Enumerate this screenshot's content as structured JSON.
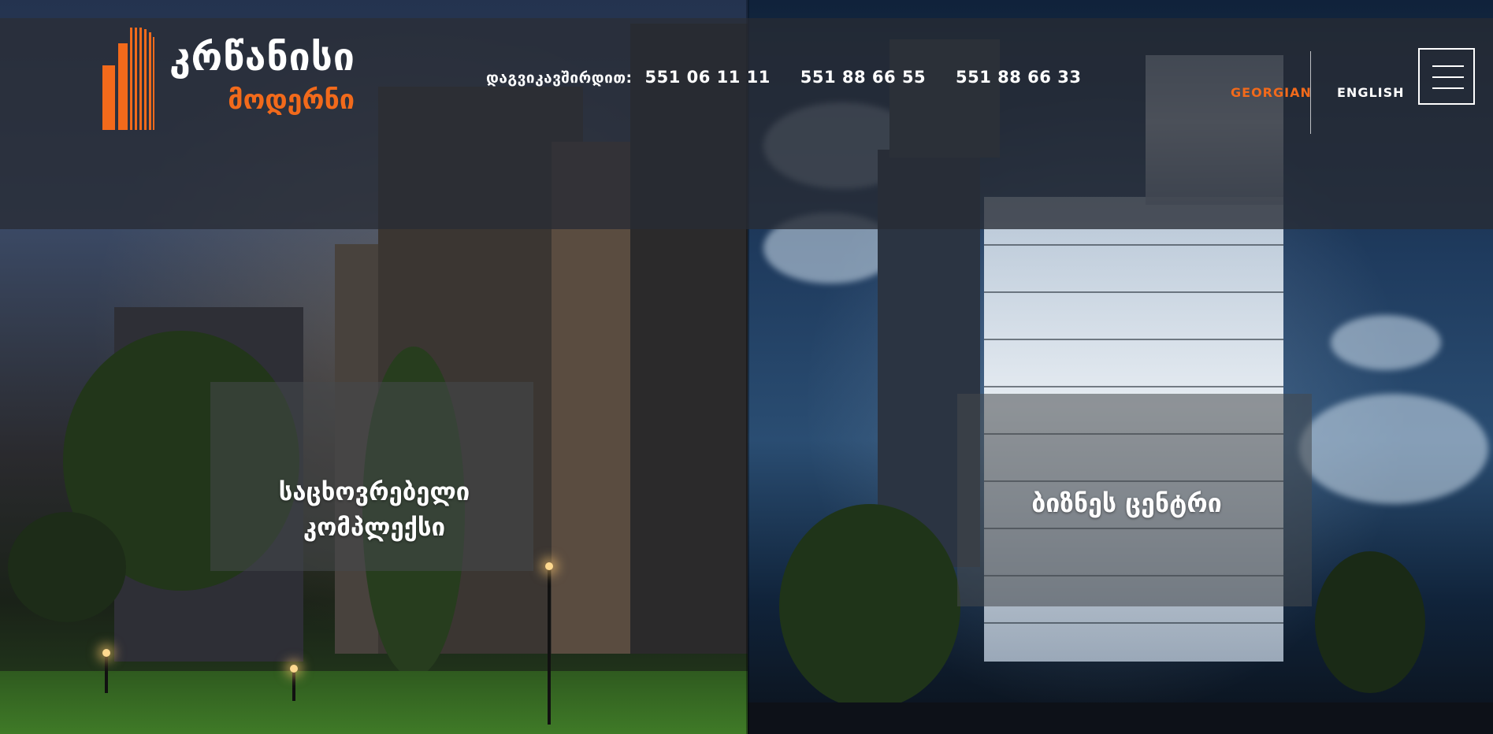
{
  "brand": {
    "name": "კრწანისი",
    "subtitle": "მოდერნი",
    "accent_color": "#f26a1b"
  },
  "contact": {
    "label": "დაგვიკავშირდით:",
    "phones": [
      "551 06 11 11",
      "551 88 66 55",
      "551 88 66 33"
    ]
  },
  "languages": {
    "georgian": "GEORGIAN",
    "english": "ENGLISH",
    "active": "GEORGIAN"
  },
  "menu": {
    "icon": "hamburger-menu-icon"
  },
  "sections": {
    "residential": {
      "line1": "საცხოვრებელი",
      "line2": "კომპლექსი"
    },
    "business": {
      "title": "ბიზნეს ცენტრი"
    }
  }
}
